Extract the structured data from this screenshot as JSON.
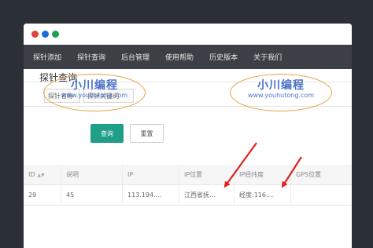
{
  "window": {
    "dots": [
      "red",
      "blue",
      "green"
    ]
  },
  "nav": {
    "items": [
      "探针添加",
      "探针查询",
      "后台管理",
      "使用帮助",
      "历史版本",
      "关于我们"
    ]
  },
  "page": {
    "title": "探针查询",
    "filter_inputs": [
      "探针名称",
      "探针关键词"
    ]
  },
  "buttons": {
    "query": "查询",
    "reset": "重置"
  },
  "table": {
    "headers": [
      "ID",
      "说明",
      "IP",
      "IP位置",
      "IP经纬度",
      "GPS位置"
    ],
    "rows": [
      [
        "29",
        "45",
        "113.194....",
        "江西省抚...",
        "经度:116....",
        ""
      ]
    ]
  },
  "watermarks": [
    {
      "name": "小川编程",
      "url": "www.youhutong.com"
    },
    {
      "name": "小川编程",
      "url": "www.youhutong.com"
    }
  ],
  "colors": {
    "background": "#2b2f36",
    "navbar": "#3c3f45",
    "primary_button": "#1f9e88",
    "arrow": "#e02020",
    "watermark_border": "#e8a040",
    "watermark_text": "#4a72c8"
  }
}
